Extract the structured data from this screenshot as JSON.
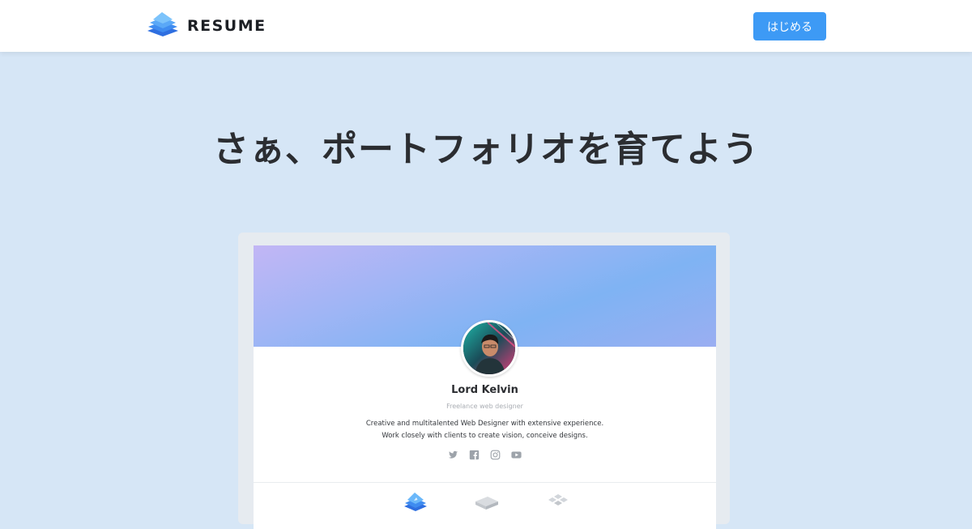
{
  "header": {
    "logo_text": "RESUME",
    "logo_icon": "stacked-pages-logo-icon",
    "start_button_label": "はじめる",
    "start_button_color": "#3d9af5"
  },
  "hero": {
    "headline": "さぁ、ポートフォリオを育てよう"
  },
  "preview": {
    "profile": {
      "name": "Lord Kelvin",
      "role": "Freelance web designer",
      "bio_line1": "Creative and multitalented Web Designer with extensive experience.",
      "bio_line2": "Work closely with clients to create vision, conceive designs."
    },
    "socials": [
      "twitter-icon",
      "facebook-icon",
      "instagram-icon",
      "youtube-icon"
    ],
    "tabs": [
      "stacked-pages-tab-icon",
      "book-tab-icon",
      "grid-tab-icon"
    ]
  },
  "colors": {
    "background": "#d6e6f6",
    "accent": "#3d9af5",
    "headline": "#2b2d31"
  }
}
